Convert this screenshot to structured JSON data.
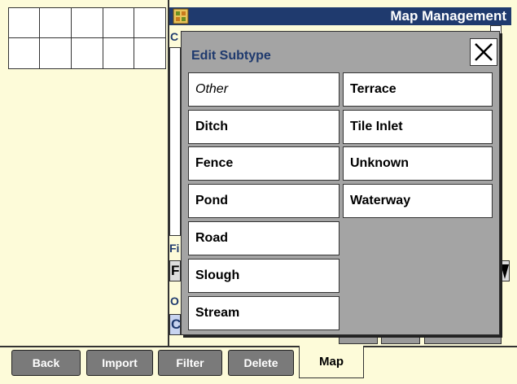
{
  "header": {
    "title": "Map Management",
    "icon": "map-management-icon"
  },
  "background": {
    "label_c": "C",
    "label_fi": "Fi",
    "label_f": "F",
    "label_o": "O",
    "label_c2": "C"
  },
  "dialog": {
    "title": "Edit Subtype",
    "close_icon": "close-icon",
    "options_left": [
      "Other",
      "Ditch",
      "Fence",
      "Pond",
      "Road",
      "Slough",
      "Stream"
    ],
    "options_right": [
      "Terrace",
      "Tile Inlet",
      "Unknown",
      "Waterway"
    ],
    "selected": "Other"
  },
  "tabs": {
    "back": "Back",
    "import": "Import",
    "filter": "Filter",
    "delete": "Delete",
    "map": "Map",
    "active": "Map"
  },
  "colors": {
    "title_bar": "#1f3a6e",
    "background": "#fdfbd9",
    "dialog": "#a4a4a4",
    "tab": "#7a7a7a"
  }
}
